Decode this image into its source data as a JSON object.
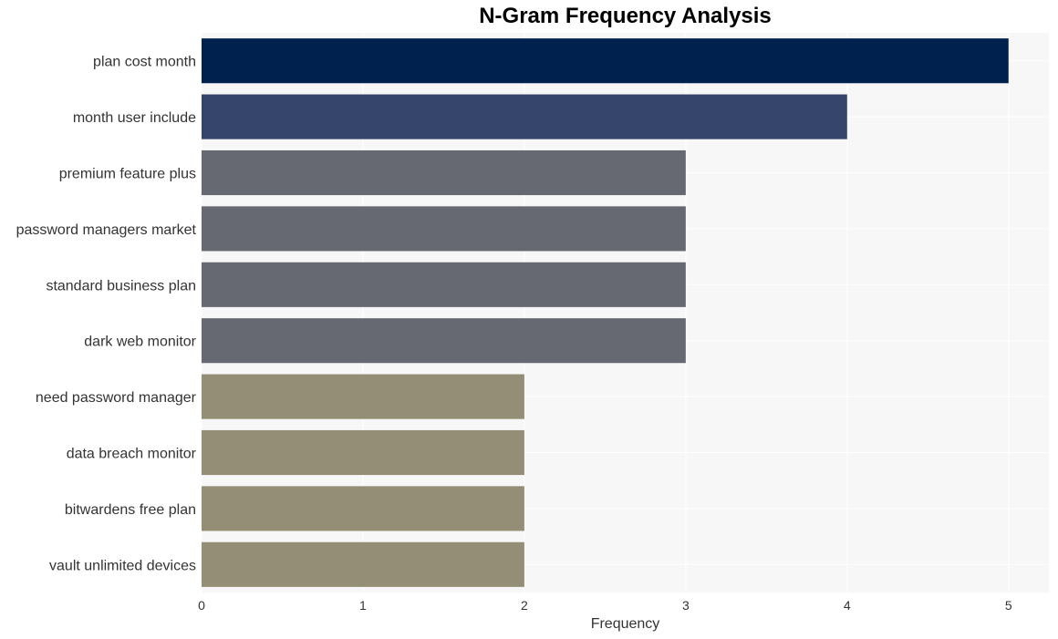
{
  "chart_data": {
    "type": "bar",
    "orientation": "horizontal",
    "title": "N-Gram Frequency Analysis",
    "xlabel": "Frequency",
    "ylabel": "",
    "xlim": [
      0,
      5.25
    ],
    "xticks": [
      0,
      1,
      2,
      3,
      4,
      5
    ],
    "grid": true,
    "categories": [
      "plan cost month",
      "month user include",
      "premium feature plus",
      "password managers market",
      "standard business plan",
      "dark web monitor",
      "need password manager",
      "data breach monitor",
      "bitwardens free plan",
      "vault unlimited devices"
    ],
    "values": [
      5,
      4,
      3,
      3,
      3,
      3,
      2,
      2,
      2,
      2
    ],
    "colors": [
      "#00204e",
      "#35456c",
      "#666971",
      "#666971",
      "#666971",
      "#666971",
      "#948e77",
      "#948e77",
      "#948e77",
      "#948e77"
    ],
    "plot_background": "#f7f7f7"
  }
}
